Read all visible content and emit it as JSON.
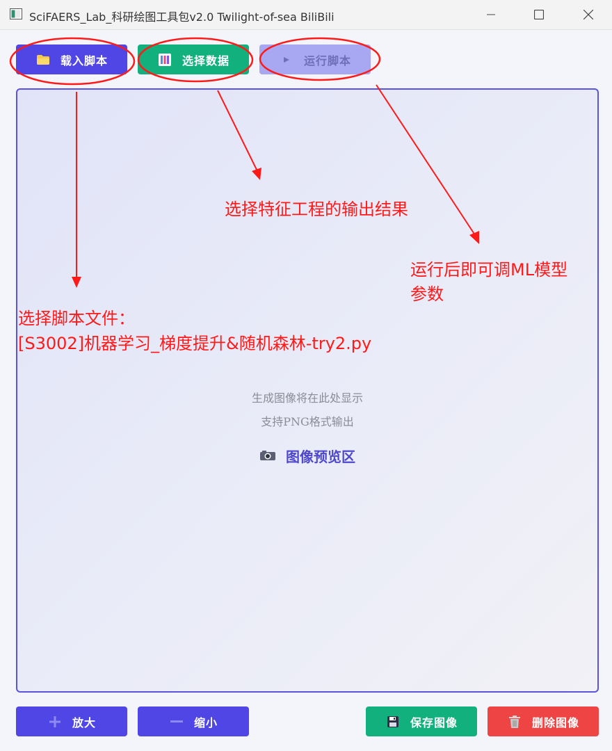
{
  "window": {
    "title": "SciFAERS_Lab_科研绘图工具包v2.0 Twilight-of-sea BiliBili",
    "minimize_icon": "minimize-icon",
    "maximize_icon": "maximize-icon",
    "close_icon": "close-icon"
  },
  "toolbar": {
    "load_script": {
      "label": "载入脚本",
      "icon": "folder-icon",
      "color": "#5046e5"
    },
    "select_data": {
      "label": "选择数据",
      "icon": "data-icon",
      "color": "#12b07c"
    },
    "run_script": {
      "label": "运行脚本",
      "icon": "play-icon",
      "color": "#a7a7f2"
    }
  },
  "preview": {
    "title": "图像预览区",
    "icon": "camera-icon",
    "line1": "生成图像将在此处显示",
    "line2": "支持PNG格式输出",
    "border_color": "#5a53e0"
  },
  "annotations": {
    "select_result": "选择特征工程的输出结果",
    "run_note_line1": "运行后即可调ML模型",
    "run_note_line2": "参数",
    "script_file_line1": "选择脚本文件：",
    "script_file_line2": "[S3002]机器学习_梯度提升&随机森林-try2.py",
    "color": "#ff1a1a"
  },
  "bottombar": {
    "zoom_in": {
      "label": "放大",
      "icon": "plus-icon",
      "color": "#5046e5"
    },
    "zoom_out": {
      "label": "缩小",
      "icon": "minus-icon",
      "color": "#5046e5"
    },
    "save_image": {
      "label": "保存图像",
      "icon": "save-icon",
      "color": "#12b07c"
    },
    "delete_image": {
      "label": "删除图像",
      "icon": "trash-icon",
      "color": "#ef4444"
    }
  }
}
